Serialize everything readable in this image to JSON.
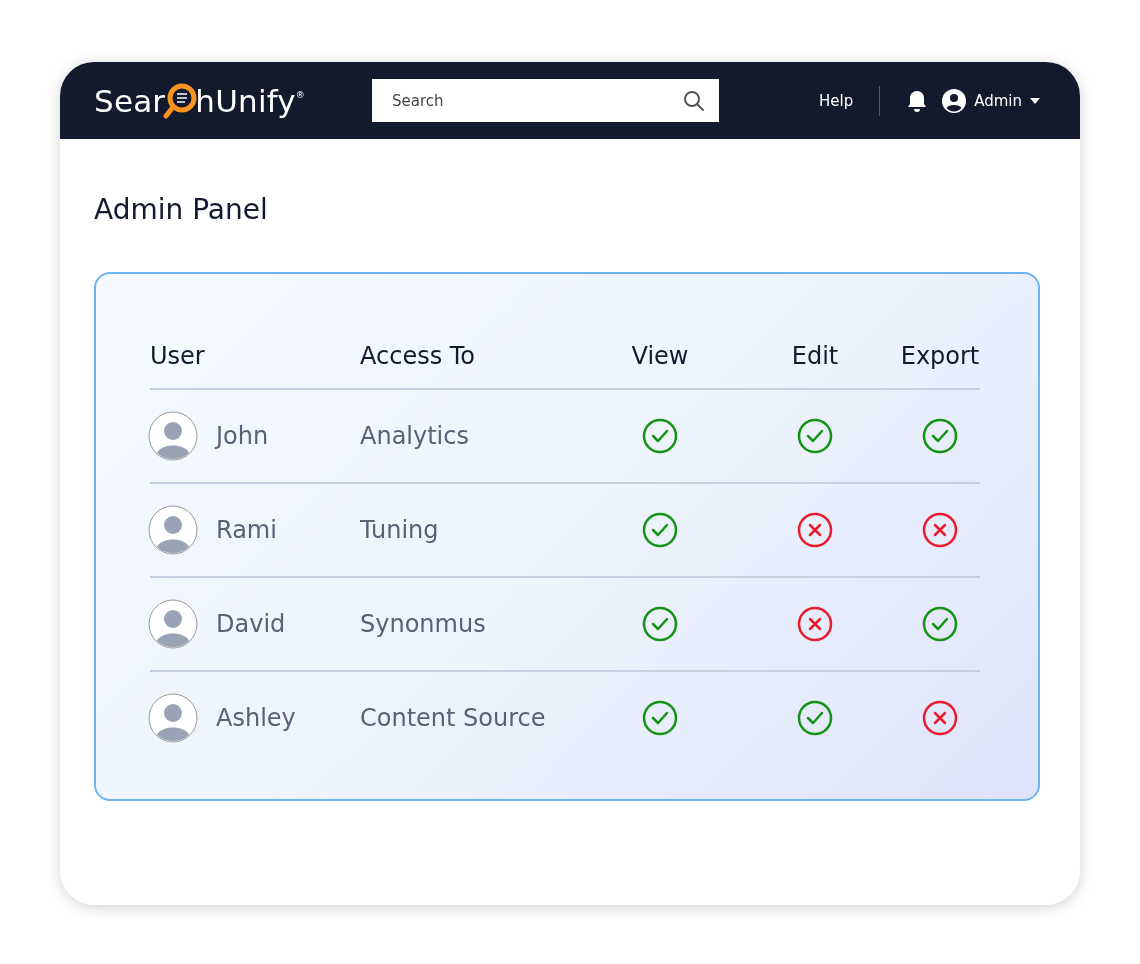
{
  "header": {
    "logo": {
      "before": "Sear",
      "after": "hUnify",
      "mark": "®"
    },
    "search": {
      "placeholder": "Search"
    },
    "help": "Help",
    "user": "Admin"
  },
  "title": "Admin Panel",
  "table": {
    "columns": [
      "User",
      "Access To",
      "View",
      "Edit",
      "Export"
    ],
    "rows": [
      {
        "user": "John",
        "access": "Analytics",
        "view": true,
        "edit": true,
        "export": true
      },
      {
        "user": "Rami",
        "access": "Tuning",
        "view": true,
        "edit": false,
        "export": false
      },
      {
        "user": "David",
        "access": "Synonmus",
        "view": true,
        "edit": false,
        "export": true
      },
      {
        "user": "Ashley",
        "access": "Content Source",
        "view": true,
        "edit": true,
        "export": false
      }
    ]
  }
}
